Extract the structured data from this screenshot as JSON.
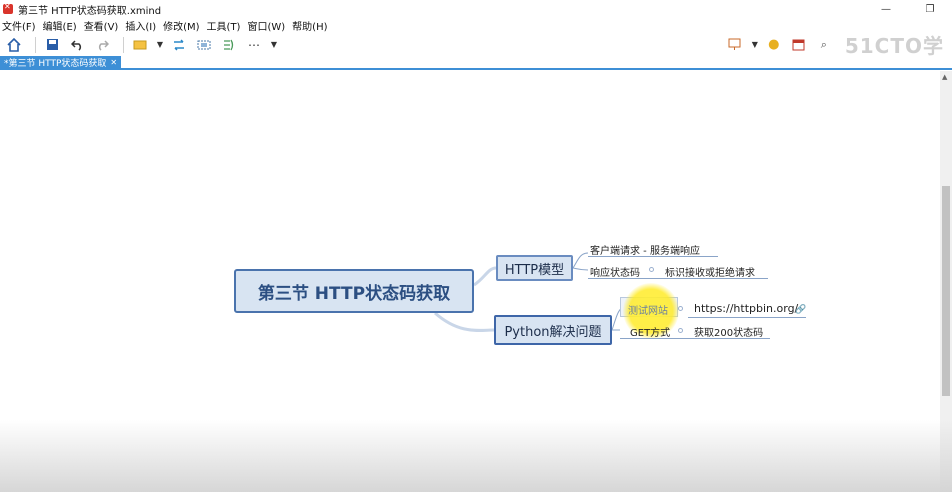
{
  "window": {
    "title": "第三节 HTTP状态码获取.xmind",
    "controls": [
      "—",
      "❐"
    ]
  },
  "menu": [
    "文件(F)",
    "编辑(E)",
    "查看(V)",
    "插入(I)",
    "修改(M)",
    "工具(T)",
    "窗口(W)",
    "帮助(H)"
  ],
  "toolbar": {
    "icons_left": [
      "home-icon",
      "save-icon",
      "undo-icon",
      "redo-icon",
      "topic-icon",
      "relationship-icon",
      "boundary-icon",
      "summary-icon",
      "more-icon"
    ],
    "icons_right": [
      "presentation-icon",
      "idea-icon",
      "panel-icon",
      "zoom-icon"
    ],
    "watermark": "51CTO学"
  },
  "tab": {
    "label": "*第三节 HTTP状态码获取",
    "close": "✕"
  },
  "mindmap": {
    "central": "第三节 HTTP状态码获取",
    "topics": [
      {
        "label": "HTTP模型",
        "children": [
          {
            "label": "客户端请求 - 服务端响应"
          },
          {
            "label": "响应状态码",
            "detail": "标识接收或拒绝请求"
          }
        ]
      },
      {
        "label": "Python解决问题",
        "children": [
          {
            "label": "测试网站",
            "detail": "https://httpbin.org/"
          },
          {
            "label": "GET方式",
            "detail": "获取200状态码"
          }
        ]
      }
    ]
  },
  "colors": {
    "accent": "#3d8fd6",
    "topic_fill": "#d8e4f2",
    "topic_border": "#4a73ad",
    "central_text": "#2c4f82"
  }
}
